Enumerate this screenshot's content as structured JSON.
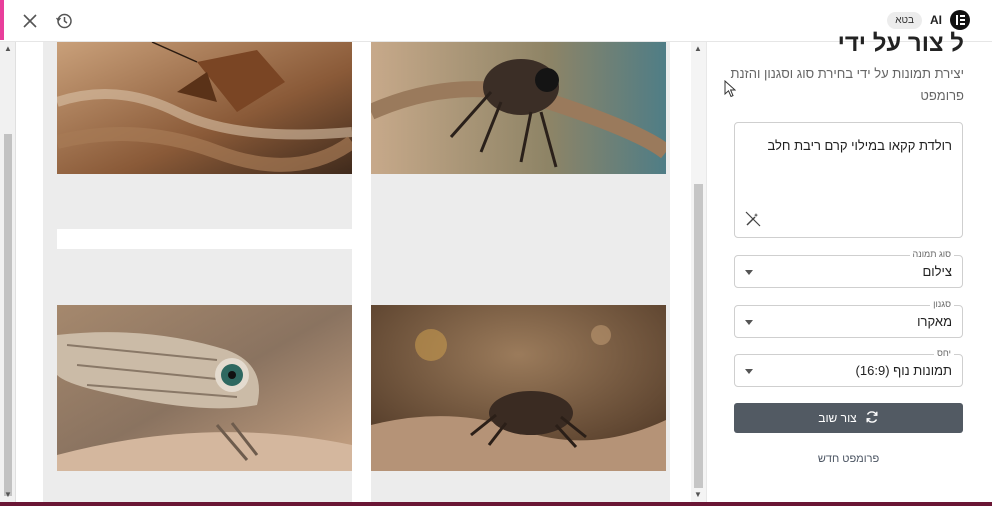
{
  "header": {
    "close_icon": "close-icon",
    "history_icon": "history-icon",
    "ai_label": "AI",
    "beta_label": "בטא",
    "logo_icon": "elementor-logo-icon"
  },
  "panel": {
    "title": "ל צור על ידי",
    "description": "יצירת תמונות על ידי בחירת סוג וסגנון והזנת פרומפט",
    "prompt_text": "רולדת קקאו במילוי קרם ריבת חלב",
    "magic_icon": "wand-off-icon",
    "image_type": {
      "label": "סוג תמונה",
      "value": "צילום"
    },
    "style": {
      "label": "סגנון",
      "value": "מאקרו"
    },
    "ratio": {
      "label": "יחס",
      "value": "תמונות נוף (16:9)"
    },
    "regenerate_label": "צור שוב",
    "regenerate_icon": "refresh-icon",
    "new_prompt_label": "פרומפט חדש"
  },
  "gallery": {
    "images": [
      {
        "subject": "moth-on-branch"
      },
      {
        "subject": "spider-on-twig"
      },
      {
        "subject": "lizard-closeup"
      },
      {
        "subject": "spider-on-sand"
      }
    ]
  },
  "colors": {
    "accent_button": "#525a63",
    "top_left_edge": "#e83e9b",
    "bottom_strip": "#6a1635"
  }
}
